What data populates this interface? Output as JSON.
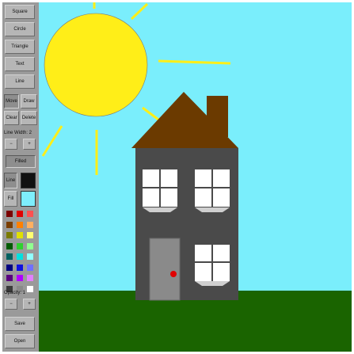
{
  "toolbar": {
    "shape_buttons": [
      "Square",
      "Circle",
      "Triangle",
      "Text",
      "Line"
    ],
    "move_label": "Move",
    "draw_label": "Draw",
    "clear_label": "Clear",
    "delete_label": "Delete",
    "line_width_label": "Line Width: 2",
    "minus_label": "−",
    "plus_label": "+",
    "filled_label": "Filled",
    "line_label": "Line",
    "fill_label": "Fill",
    "line_color": "#111111",
    "fill_color": "#7eeefc",
    "opacity_label": "Opacity: 1",
    "save_label": "Save",
    "open_label": "Open",
    "palette": [
      [
        "#7a0000",
        "#e00000",
        "#ff5050"
      ],
      [
        "#7a3d00",
        "#ff8000",
        "#ffb060"
      ],
      [
        "#7a7a00",
        "#e0e000",
        "#ffff70"
      ],
      [
        "#005a00",
        "#30d030",
        "#90ff90"
      ],
      [
        "#006060",
        "#00e0e0",
        "#90ffff"
      ],
      [
        "#000080",
        "#1010e0",
        "#7070ff"
      ],
      [
        "#5a0080",
        "#b000ff",
        "#e080ff"
      ],
      [
        "#3a3a3a",
        "#8a8a8a",
        "#ffffff"
      ]
    ]
  },
  "canvas": {
    "colors": {
      "sky": "#7aeefc",
      "grass": "#1a6400",
      "sun": "#ffee18",
      "sun_rays": "#ffee18",
      "roof": "#6b3a00",
      "chimney": "#6b3a00",
      "house": "#4a4a4a",
      "window": "#ffffff",
      "door": "#8a8a8a",
      "door_knob": "#e00000"
    }
  }
}
